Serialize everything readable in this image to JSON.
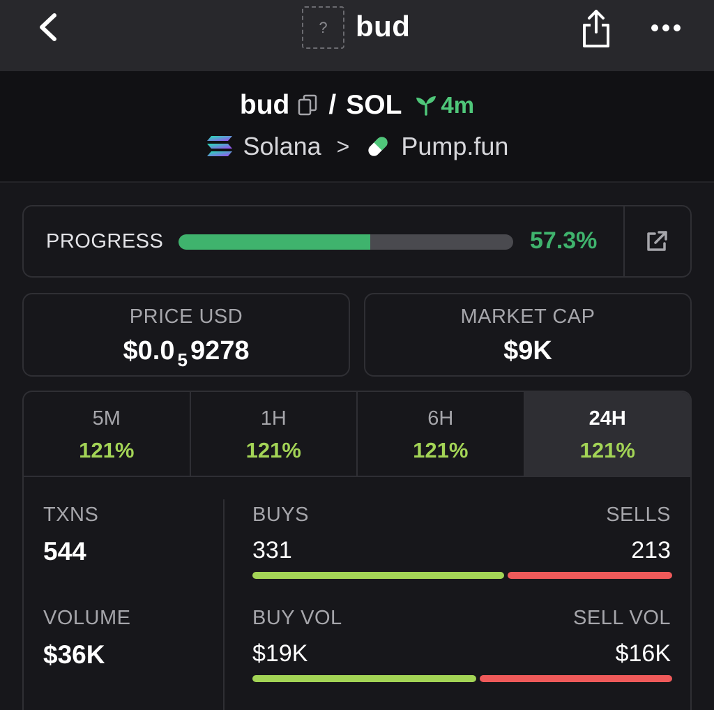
{
  "nav": {
    "title": "bud",
    "thumb_placeholder": "?"
  },
  "pair": {
    "base": "bud",
    "slash": "/",
    "quote": "SOL",
    "age": "4m"
  },
  "chain": {
    "network": "Solana",
    "separator": ">",
    "dex": "Pump.fun"
  },
  "progress": {
    "label": "PROGRESS",
    "value_text": "57.3%",
    "fraction": 0.573
  },
  "price": {
    "label": "PRICE USD",
    "prefix": "$0.0",
    "zeros": "5",
    "suffix": "9278"
  },
  "market_cap": {
    "label": "MARKET CAP",
    "value": "$9K"
  },
  "timeframes": [
    {
      "name": "5M",
      "change": "121%"
    },
    {
      "name": "1H",
      "change": "121%"
    },
    {
      "name": "6H",
      "change": "121%"
    },
    {
      "name": "24H",
      "change": "121%"
    }
  ],
  "active_timeframe": "24H",
  "stats": {
    "txns_label": "TXNS",
    "txns": "544",
    "volume_label": "VOLUME",
    "volume": "$36K",
    "buys_label": "BUYS",
    "buys": "331",
    "sells_label": "SELLS",
    "sells": "213",
    "buy_vol_label": "BUY VOL",
    "buy_vol": "$19K",
    "sell_vol_label": "SELL VOL",
    "sell_vol": "$16K"
  },
  "colors": {
    "positive": "#a3d456",
    "progress": "#3fb36d",
    "negative": "#ef5a5a"
  }
}
